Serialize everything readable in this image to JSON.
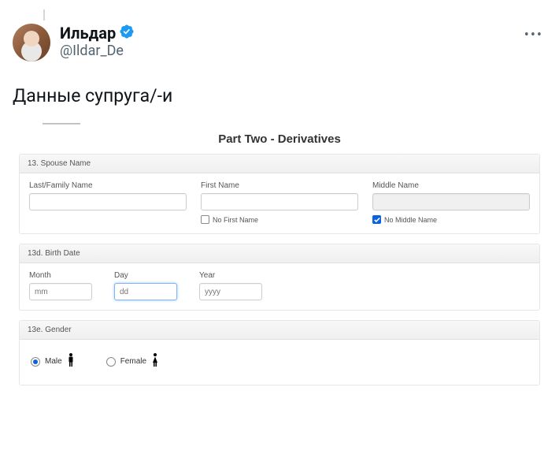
{
  "profile": {
    "display_name": "Ильдар",
    "username": "@Ildar_De"
  },
  "tweet_text": "Данные супруга/-и",
  "form": {
    "title": "Part Two - Derivatives",
    "section13": {
      "header": "13. Spouse Name",
      "last_name_label": "Last/Family Name",
      "first_name_label": "First Name",
      "middle_name_label": "Middle Name",
      "no_first_label": "No First Name",
      "no_middle_label": "No Middle Name",
      "no_first_checked": false,
      "no_middle_checked": true
    },
    "section13d": {
      "header": "13d. Birth Date",
      "month_label": "Month",
      "day_label": "Day",
      "year_label": "Year",
      "month_ph": "mm",
      "day_ph": "dd",
      "year_ph": "yyyy"
    },
    "section13e": {
      "header": "13e. Gender",
      "male_label": "Male",
      "female_label": "Female",
      "selected": "male"
    }
  }
}
